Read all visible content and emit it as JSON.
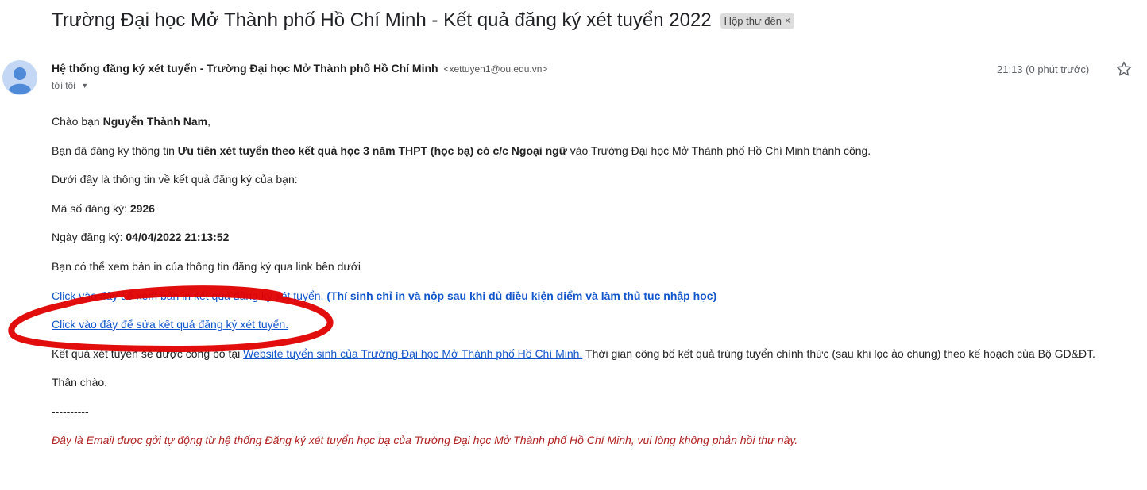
{
  "subject": "Trường Đại học Mở Thành phố Hồ Chí Minh - Kết quả đăng ký xét tuyển 2022",
  "label": "Hộp thư đến",
  "label_close": "×",
  "sender": {
    "name": "Hệ thống đăng ký xét tuyển - Trường Đại học Mở Thành phố Hồ Chí Minh",
    "email": "<xettuyen1@ou.edu.vn>",
    "to": "tới tôi",
    "time": "21:13 (0 phút trước)"
  },
  "body": {
    "greeting_prefix": "Chào bạn ",
    "greeting_name": "Nguyễn Thành Nam",
    "greeting_suffix": ",",
    "line1_prefix": "Bạn đã đăng ký thông tin ",
    "line1_bold": "Ưu tiên xét tuyển theo kết quả học 3 năm THPT (học bạ) có c/c Ngoại ngữ",
    "line1_suffix": " vào Trường Đại học Mở Thành phố Hồ Chí Minh thành công.",
    "line2": "Dưới đây là thông tin về kết quả đăng ký của bạn:",
    "reg_code_label": "Mã số đăng ký: ",
    "reg_code": "2926",
    "reg_date_label": "Ngày đăng ký: ",
    "reg_date": "04/04/2022 21:13:52",
    "print_info": "Bạn có thể xem bản in của thông tin đăng ký qua link bên dưới",
    "print_link": "Click vào đây để xem bản in kết quả đăng ký xét tuyển.",
    "print_note": "(Thí sinh chỉ in và nộp sau khi đủ điều kiện điểm và làm thủ tục nhập học)",
    "edit_link": "Click vào đây để sửa kết quả đăng ký xét tuyển.",
    "result_prefix": "Kết quả xét tuyển sẽ được công bố tại ",
    "website_link": "Website tuyển sinh của Trường Đại học Mở Thành phố Hồ Chí Minh.",
    "result_suffix": " Thời gian công bố kết quả trúng tuyển chính thức (sau khi lọc ảo chung) theo kế hoạch của Bộ GD&ĐT.",
    "closing": "Thân chào.",
    "separator": "----------",
    "footer": "Đây là Email được gởi tự động từ hệ thống Đăng ký xét tuyển học bạ của Trường Đại học Mở Thành phố Hồ Chí Minh, vui lòng không phản hồi thư này."
  },
  "icons": {
    "avatar": "default-avatar-icon",
    "star": "star-outline-icon",
    "caret": "caret-down-icon"
  },
  "colors": {
    "link": "#1155cc",
    "footer": "#b22222",
    "annotation": "#e00000",
    "avatar_bg": "#c4d8f5",
    "avatar_fg": "#4f8ad9"
  }
}
